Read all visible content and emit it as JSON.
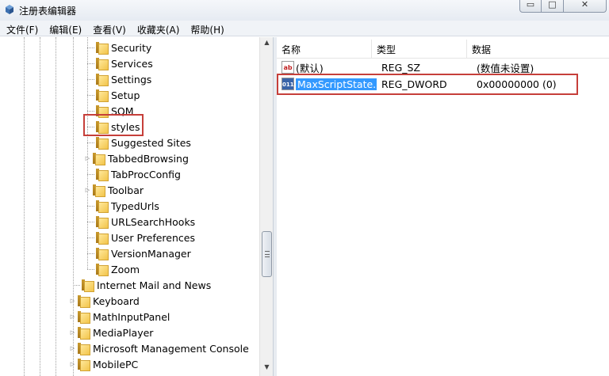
{
  "window": {
    "title": "注册表编辑器",
    "app_icon": "registry-cube-icon",
    "min_glyph": "▭",
    "max_glyph": "□",
    "close_glyph": "✕"
  },
  "menu": [
    {
      "label": "文件(F)"
    },
    {
      "label": "编辑(E)"
    },
    {
      "label": "查看(V)"
    },
    {
      "label": "收藏夹(A)"
    },
    {
      "label": "帮助(H)"
    }
  ],
  "tree": {
    "children": [
      {
        "label": "Security"
      },
      {
        "label": "Services"
      },
      {
        "label": "Settings"
      },
      {
        "label": "Setup"
      },
      {
        "label": "SQM"
      },
      {
        "label": "styles"
      },
      {
        "label": "Suggested Sites"
      },
      {
        "label": "TabbedBrowsing"
      },
      {
        "label": "TabProcConfig"
      },
      {
        "label": "Toolbar"
      },
      {
        "label": "TypedUrls"
      },
      {
        "label": "URLSearchHooks"
      },
      {
        "label": "User Preferences"
      },
      {
        "label": "VersionManager"
      },
      {
        "label": "Zoom"
      }
    ],
    "siblings": [
      {
        "label": "Internet Mail and News"
      },
      {
        "label": "Keyboard"
      },
      {
        "label": "MathInputPanel"
      },
      {
        "label": "MediaPlayer"
      },
      {
        "label": "Microsoft Management Console"
      },
      {
        "label": "MobilePC"
      }
    ],
    "expander_glyph": "▷",
    "scroll_up_glyph": "▲",
    "scroll_down_glyph": "▼"
  },
  "list": {
    "columns": {
      "name": "名称",
      "type": "类型",
      "data": "数据"
    },
    "rows": [
      {
        "icon": "string-value-icon",
        "icon_text": "ab",
        "name": "(默认)",
        "type": "REG_SZ",
        "data": "(数值未设置)"
      },
      {
        "icon": "dword-value-icon",
        "icon_text": "011",
        "name": "MaxScriptState...",
        "type": "REG_DWORD",
        "data": "0x00000000 (0)"
      }
    ]
  },
  "colors": {
    "selection": "#3399ff",
    "annotation": "#c63f3a"
  }
}
